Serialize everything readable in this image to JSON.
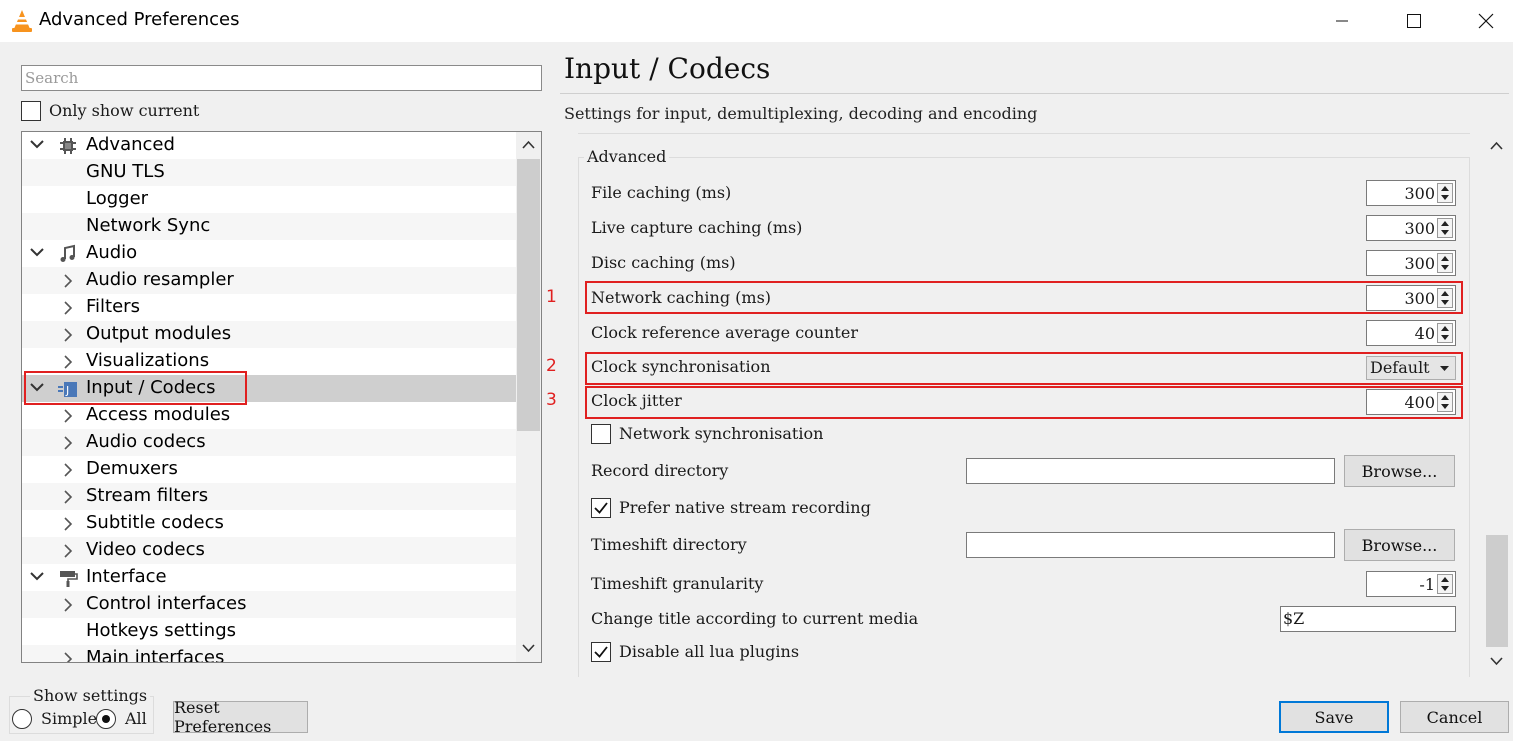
{
  "window": {
    "title": "Advanced Preferences",
    "controls": [
      "minimize",
      "maximize",
      "close"
    ]
  },
  "left": {
    "search_placeholder": "Search",
    "only_show_current": "Only show current",
    "tree": [
      {
        "label": "Advanced",
        "level": 0,
        "expanded": true,
        "icon": "chip-icon"
      },
      {
        "label": "GNU TLS",
        "level": 1
      },
      {
        "label": "Logger",
        "level": 1
      },
      {
        "label": "Network Sync",
        "level": 1
      },
      {
        "label": "Audio",
        "level": 0,
        "expanded": true,
        "icon": "music-note-icon"
      },
      {
        "label": "Audio resampler",
        "level": 1,
        "has_children": true
      },
      {
        "label": "Filters",
        "level": 1,
        "has_children": true
      },
      {
        "label": "Output modules",
        "level": 1,
        "has_children": true
      },
      {
        "label": "Visualizations",
        "level": 1,
        "has_children": true
      },
      {
        "label": "Input / Codecs",
        "level": 0,
        "expanded": true,
        "selected": true,
        "highlighted": true,
        "icon": "codec-icon"
      },
      {
        "label": "Access modules",
        "level": 1,
        "has_children": true
      },
      {
        "label": "Audio codecs",
        "level": 1,
        "has_children": true
      },
      {
        "label": "Demuxers",
        "level": 1,
        "has_children": true
      },
      {
        "label": "Stream filters",
        "level": 1,
        "has_children": true
      },
      {
        "label": "Subtitle codecs",
        "level": 1,
        "has_children": true
      },
      {
        "label": "Video codecs",
        "level": 1,
        "has_children": true
      },
      {
        "label": "Interface",
        "level": 0,
        "expanded": true,
        "icon": "paint-roller-icon"
      },
      {
        "label": "Control interfaces",
        "level": 1,
        "has_children": true
      },
      {
        "label": "Hotkeys settings",
        "level": 1
      },
      {
        "label": "Main interfaces",
        "level": 1,
        "has_children": true
      }
    ]
  },
  "right": {
    "title": "Input / Codecs",
    "subtitle": "Settings for input, demultiplexing, decoding and encoding",
    "group_title": "Advanced",
    "file_caching": {
      "label": "File caching (ms)",
      "value": "300"
    },
    "live_caching": {
      "label": "Live capture caching (ms)",
      "value": "300"
    },
    "disc_caching": {
      "label": "Disc caching (ms)",
      "value": "300"
    },
    "network_caching": {
      "label": "Network caching (ms)",
      "value": "300",
      "marker": "1"
    },
    "clock_ref": {
      "label": "Clock reference average counter",
      "value": "40"
    },
    "clock_sync": {
      "label": "Clock synchronisation",
      "value": "Default",
      "marker": "2"
    },
    "clock_jitter": {
      "label": "Clock jitter",
      "value": "400",
      "marker": "3"
    },
    "network_sync": {
      "label": "Network synchronisation",
      "checked": false
    },
    "record_dir": {
      "label": "Record directory",
      "value": "",
      "browse": "Browse..."
    },
    "native_recording": {
      "label": "Prefer native stream recording",
      "checked": true
    },
    "timeshift_dir": {
      "label": "Timeshift directory",
      "value": "",
      "browse": "Browse..."
    },
    "timeshift_gran": {
      "label": "Timeshift granularity",
      "value": "-1"
    },
    "change_title": {
      "label": "Change title according to current media",
      "value": "$Z"
    },
    "disable_lua": {
      "label": "Disable all lua plugins",
      "checked": true
    }
  },
  "bottom": {
    "show_settings": "Show settings",
    "simple": "Simple",
    "all": "All",
    "selected_mode": "All",
    "reset": "Reset Preferences",
    "save": "Save",
    "cancel": "Cancel"
  },
  "colors": {
    "highlight": "#e02020",
    "selected_row": "#cfcfcf",
    "save_border": "#0078d7"
  }
}
